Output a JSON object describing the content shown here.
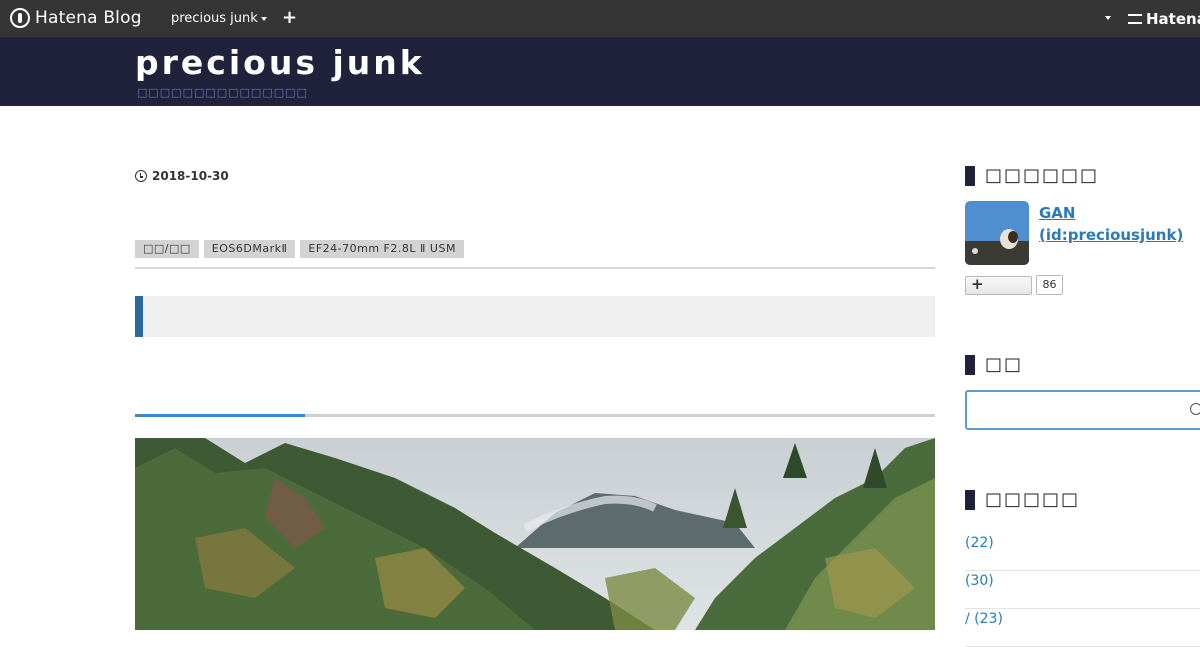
{
  "topbar": {
    "logo_text": "Hatena Blog",
    "blog_menu": "precious junk",
    "add_icon": "+",
    "hatena_text": "Hatena"
  },
  "header": {
    "title": "precious junk",
    "description": "□□□□□□□□□□□□□□□"
  },
  "article": {
    "date": "2018-10-30",
    "tags": [
      "□□/□□",
      "EOS6DMarkⅡ",
      "EF24-70mm F2.8L Ⅱ USM"
    ],
    "reading_progress": 0.2125
  },
  "sidebar": {
    "profile_heading": "□□□□□□",
    "profile_name": "GAN",
    "profile_id": "(id:preciousjunk)",
    "star_count": "86",
    "search_heading": "□□",
    "category_heading": "□□□□□",
    "categories": [
      {
        "label": " (22)"
      },
      {
        "label": " (30)"
      },
      {
        "label": "/ (23)"
      }
    ]
  },
  "colors": {
    "topbar_bg": "#353535",
    "header_bg": "#20213a",
    "accent_blue": "#2a6aa0",
    "link_blue": "#2a7ab6"
  }
}
